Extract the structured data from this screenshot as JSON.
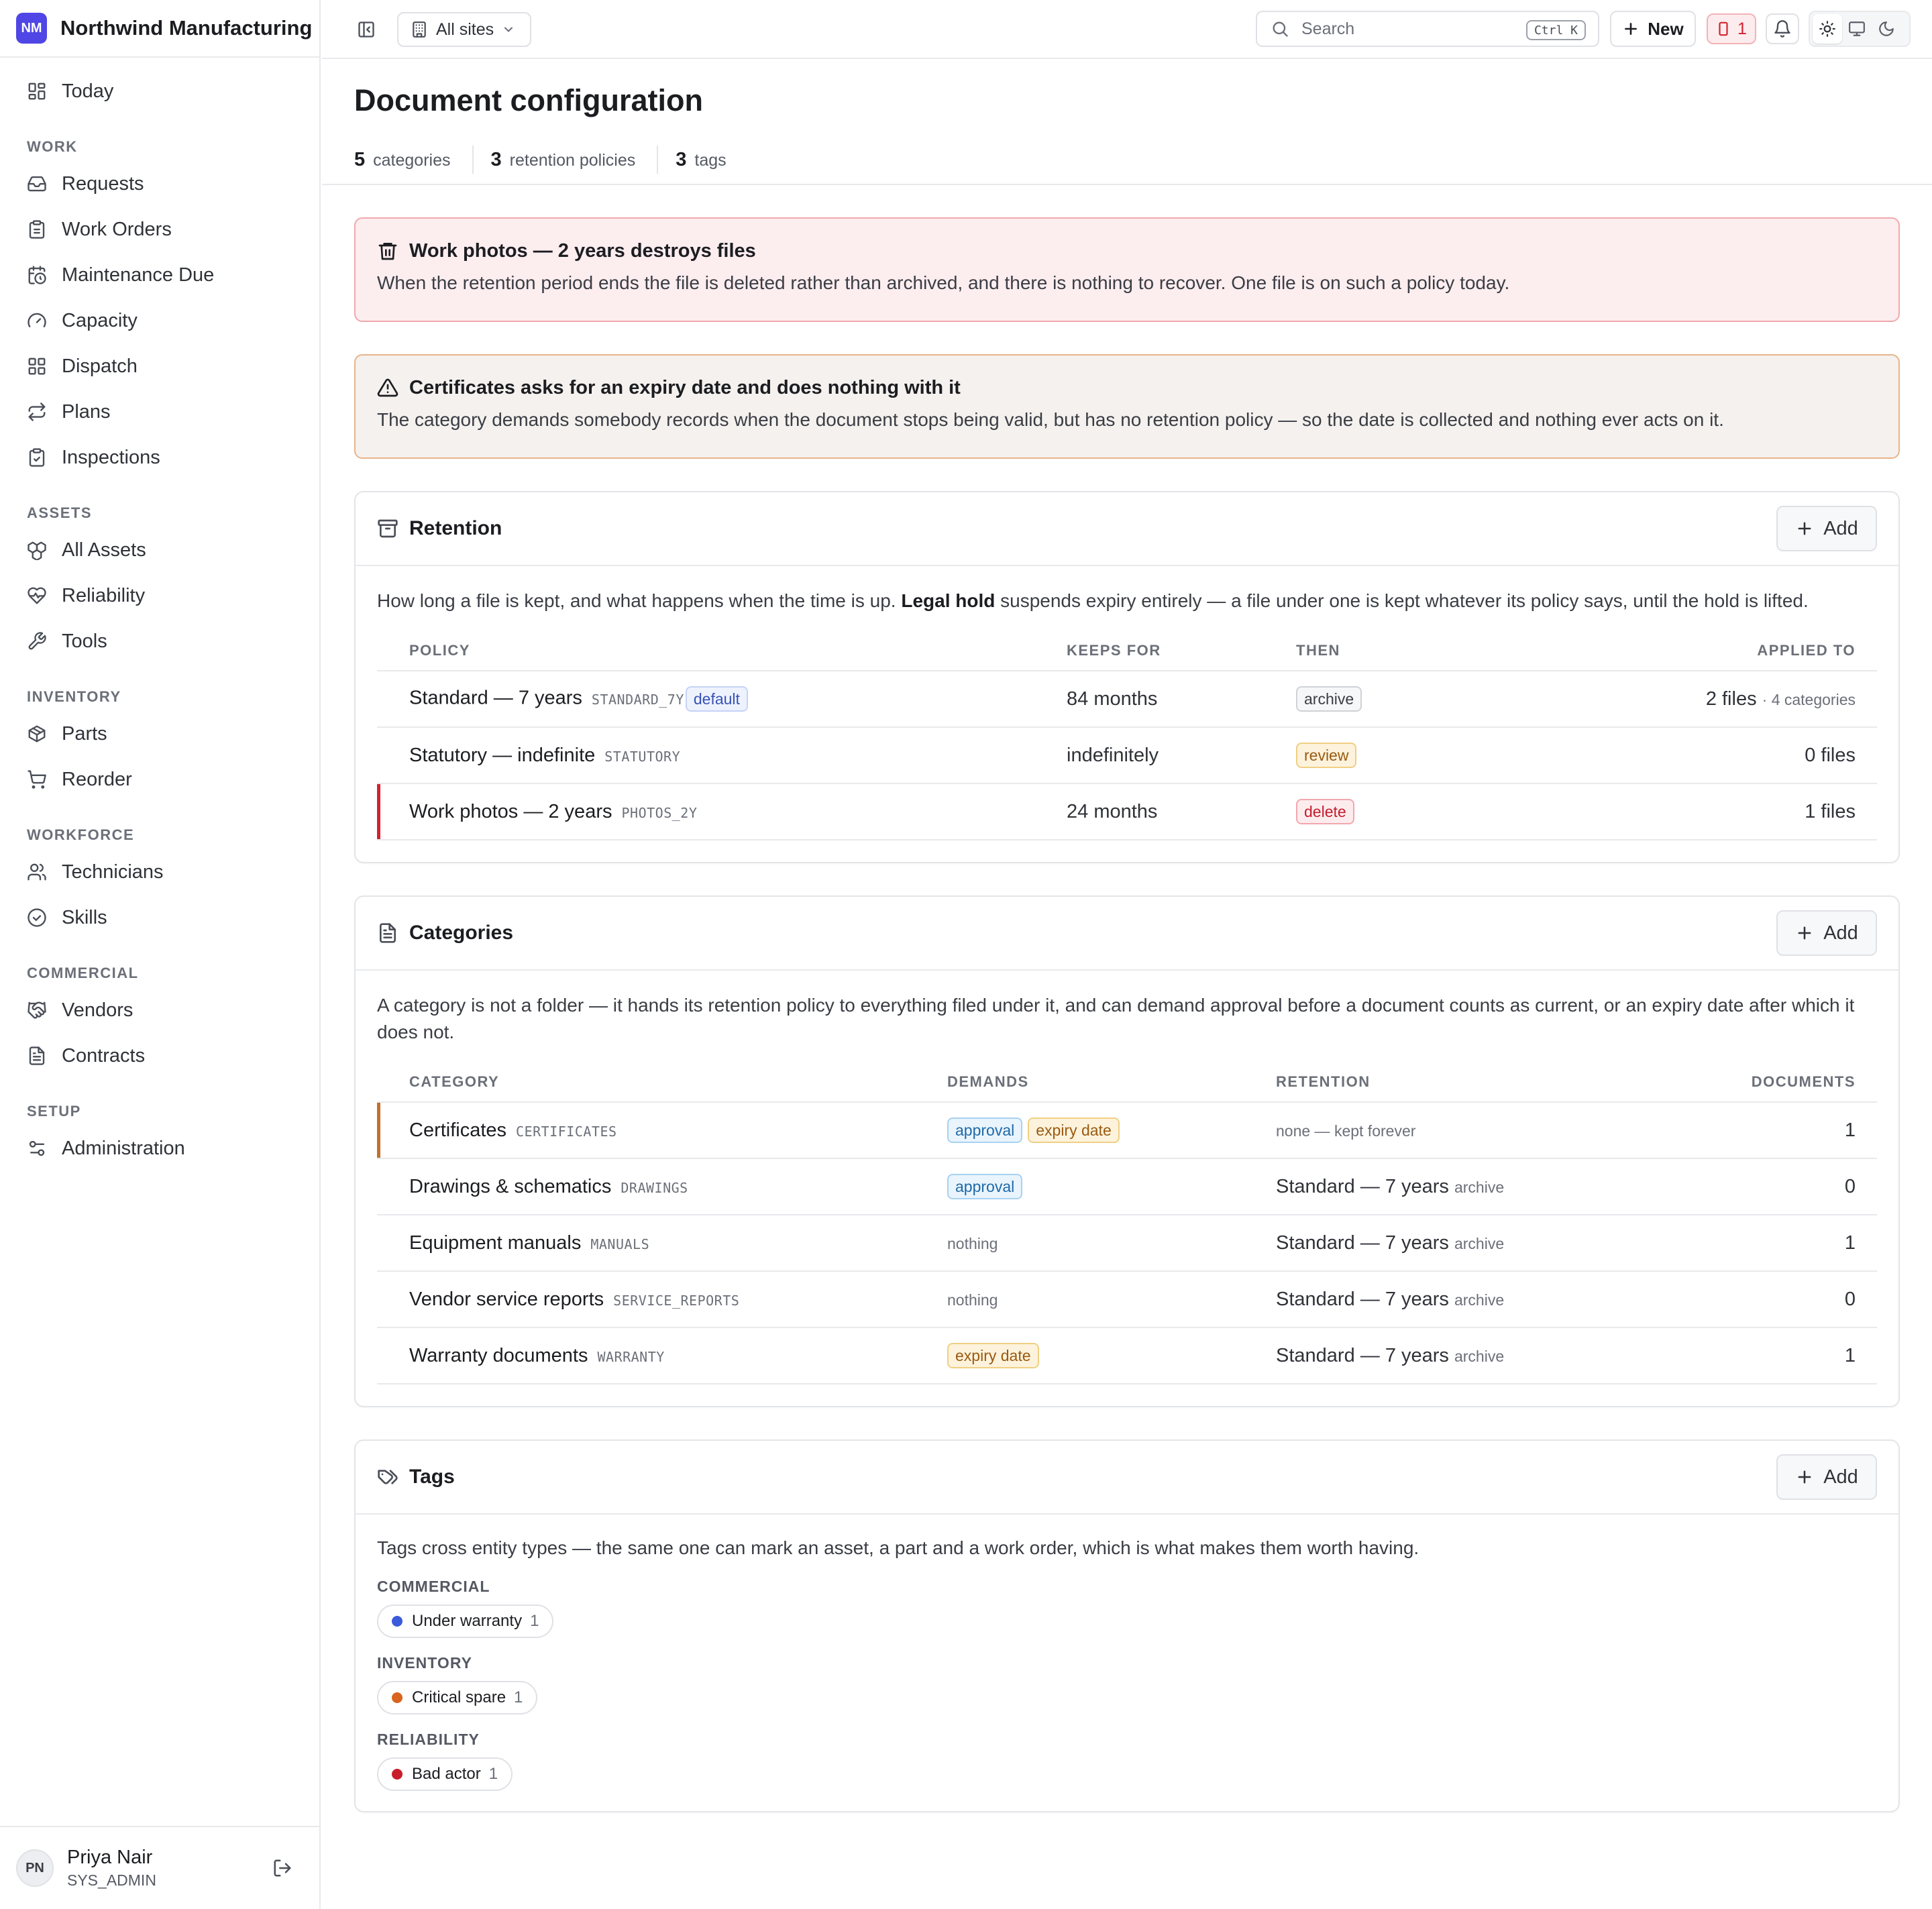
{
  "brand": {
    "initials": "NM",
    "name": "Northwind Manufacturing"
  },
  "nav": {
    "top": [
      {
        "label": "Today",
        "icon": "dashboard-icon"
      }
    ],
    "sections": [
      {
        "title": "WORK",
        "items": [
          {
            "label": "Requests",
            "icon": "inbox-icon"
          },
          {
            "label": "Work Orders",
            "icon": "clipboard-icon"
          },
          {
            "label": "Maintenance Due",
            "icon": "calendar-clock-icon"
          },
          {
            "label": "Capacity",
            "icon": "gauge-icon"
          },
          {
            "label": "Dispatch",
            "icon": "grid-icon"
          },
          {
            "label": "Plans",
            "icon": "repeat-icon"
          },
          {
            "label": "Inspections",
            "icon": "clipboard-check-icon"
          }
        ]
      },
      {
        "title": "ASSETS",
        "items": [
          {
            "label": "All Assets",
            "icon": "boxes-icon"
          },
          {
            "label": "Reliability",
            "icon": "heart-pulse-icon"
          },
          {
            "label": "Tools",
            "icon": "wrench-icon"
          }
        ]
      },
      {
        "title": "INVENTORY",
        "items": [
          {
            "label": "Parts",
            "icon": "package-icon"
          },
          {
            "label": "Reorder",
            "icon": "cart-icon"
          }
        ]
      },
      {
        "title": "WORKFORCE",
        "items": [
          {
            "label": "Technicians",
            "icon": "users-icon"
          },
          {
            "label": "Skills",
            "icon": "badge-check-icon"
          }
        ]
      },
      {
        "title": "COMMERCIAL",
        "items": [
          {
            "label": "Vendors",
            "icon": "handshake-icon"
          },
          {
            "label": "Contracts",
            "icon": "file-text-icon"
          }
        ]
      },
      {
        "title": "SETUP",
        "items": [
          {
            "label": "Administration",
            "icon": "sliders-icon"
          }
        ]
      }
    ]
  },
  "user": {
    "initials": "PN",
    "name": "Priya Nair",
    "role": "SYS_ADMIN"
  },
  "topbar": {
    "site": "All sites",
    "search_placeholder": "Search",
    "shortcut": "Ctrl K",
    "new_label": "New",
    "alert_count": "1"
  },
  "page": {
    "title": "Document configuration",
    "stats": [
      {
        "n": "5",
        "label": "categories"
      },
      {
        "n": "3",
        "label": "retention policies"
      },
      {
        "n": "3",
        "label": "tags"
      }
    ]
  },
  "banners": {
    "danger": {
      "title": "Work photos — 2 years destroys files",
      "body": "When the retention period ends the file is deleted rather than archived, and there is nothing to recover. One file is on such a policy today.",
      "color": "#d3222f"
    },
    "warn": {
      "title": "Certificates asks for an expiry date and does nothing with it",
      "body": "The category demands somebody records when the document stops being valid, but has no retention policy — so the date is collected and nothing ever acts on it.",
      "color": "#c2702b"
    }
  },
  "retention": {
    "title": "Retention",
    "add_label": "Add",
    "desc_pre": "How long a file is kept, and what happens when the time is up. ",
    "desc_bold": "Legal hold",
    "desc_post": " suspends expiry entirely — a file under one is kept whatever its policy says, until the hold is lifted.",
    "headers": [
      "POLICY",
      "KEEPS FOR",
      "THEN",
      "APPLIED TO"
    ],
    "rows": [
      {
        "name": "Standard — 7 years",
        "code": "STANDARD_7Y",
        "default": "default",
        "keeps": "84 months",
        "then": "archive",
        "applied": "2 files",
        "applied_extra": "· 4 categories",
        "flag": ""
      },
      {
        "name": "Statutory — indefinite",
        "code": "STATUTORY",
        "default": "",
        "keeps": "indefinitely",
        "then": "review",
        "applied": "0 files",
        "applied_extra": "",
        "flag": ""
      },
      {
        "name": "Work photos — 2 years",
        "code": "PHOTOS_2Y",
        "default": "",
        "keeps": "24 months",
        "then": "delete",
        "applied": "1 files",
        "applied_extra": "",
        "flag": "red"
      }
    ]
  },
  "categories": {
    "title": "Categories",
    "add_label": "Add",
    "desc": "A category is not a folder — it hands its retention policy to everything filed under it, and can demand approval before a document counts as current, or an expiry date after which it does not.",
    "headers": [
      "CATEGORY",
      "DEMANDS",
      "RETENTION",
      "DOCUMENTS"
    ],
    "rows": [
      {
        "name": "Certificates",
        "code": "CERTIFICATES",
        "demands": [
          "approval",
          "expiry date"
        ],
        "retention": "",
        "retention_action": "none — kept forever",
        "docs": "1",
        "flag": "amber"
      },
      {
        "name": "Drawings & schematics",
        "code": "DRAWINGS",
        "demands": [
          "approval"
        ],
        "retention": "Standard — 7 years",
        "retention_action": "archive",
        "docs": "0",
        "flag": ""
      },
      {
        "name": "Equipment manuals",
        "code": "MANUALS",
        "demands": [],
        "demands_none": "nothing",
        "retention": "Standard — 7 years",
        "retention_action": "archive",
        "docs": "1",
        "flag": ""
      },
      {
        "name": "Vendor service reports",
        "code": "SERVICE_REPORTS",
        "demands": [],
        "demands_none": "nothing",
        "retention": "Standard — 7 years",
        "retention_action": "archive",
        "docs": "0",
        "flag": ""
      },
      {
        "name": "Warranty documents",
        "code": "WARRANTY",
        "demands": [
          "expiry date"
        ],
        "retention": "Standard — 7 years",
        "retention_action": "archive",
        "docs": "1",
        "flag": ""
      }
    ]
  },
  "tags": {
    "title": "Tags",
    "add_label": "Add",
    "desc": "Tags cross entity types — the same one can mark an asset, a part and a work order, which is what makes them worth having.",
    "groups": [
      {
        "label": "COMMERCIAL",
        "tags": [
          {
            "name": "Under warranty",
            "count": "1",
            "color": "#3b5bdb"
          }
        ]
      },
      {
        "label": "INVENTORY",
        "tags": [
          {
            "name": "Critical spare",
            "count": "1",
            "color": "#d9641e"
          }
        ]
      },
      {
        "label": "RELIABILITY",
        "tags": [
          {
            "name": "Bad actor",
            "count": "1",
            "color": "#c81e2b"
          }
        ]
      }
    ]
  }
}
